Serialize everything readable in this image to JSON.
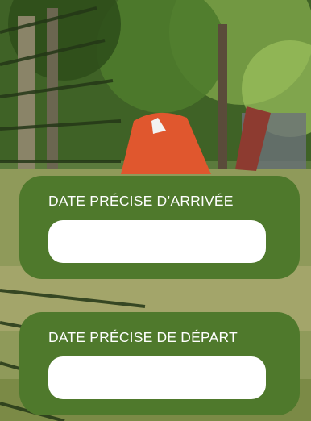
{
  "form": {
    "arrival": {
      "label": "DATE PRÉCISE D’ARRIVÉE",
      "value": "",
      "placeholder": ""
    },
    "departure": {
      "label": "DATE PRÉCISE DE DÉPART",
      "value": "",
      "placeholder": ""
    }
  },
  "colors": {
    "card_background": "#4f792c",
    "input_background": "#ffffff",
    "label_text": "#ffffff"
  }
}
